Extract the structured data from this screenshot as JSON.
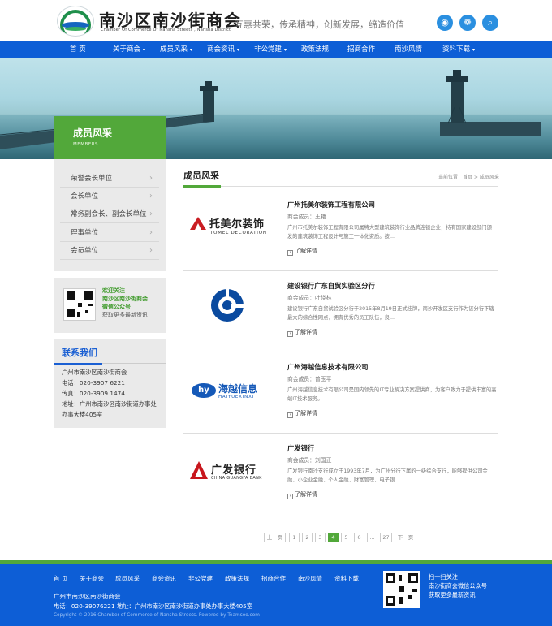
{
  "header": {
    "logo_cn": "南沙区南沙街商会",
    "logo_en": "Chamber Of Commerce Of Nansha Streets , Nansha District",
    "slogan": "互惠共荣，传承精神，创新发展，缔造价值"
  },
  "nav": [
    {
      "label": "首 页"
    },
    {
      "label": "关于商会",
      "dropdown": true
    },
    {
      "label": "成员风采",
      "dropdown": true
    },
    {
      "label": "商会资讯",
      "dropdown": true
    },
    {
      "label": "非公党建",
      "dropdown": true
    },
    {
      "label": "政策法规"
    },
    {
      "label": "招商合作"
    },
    {
      "label": "南沙风情"
    },
    {
      "label": "资料下载",
      "dropdown": true
    }
  ],
  "banner": {
    "title": "成员风采",
    "title_en": "MEMBERS"
  },
  "sidebar": {
    "items": [
      {
        "label": "荣誉会长单位"
      },
      {
        "label": "会长单位"
      },
      {
        "label": "常务副会长、副会长单位"
      },
      {
        "label": "理事单位"
      },
      {
        "label": "会员单位"
      }
    ],
    "qr": {
      "line1": "欢迎关注",
      "line2": "南沙区南沙街商会",
      "line3": "微信公众号",
      "line4": "获取更多最新资讯"
    },
    "contact": {
      "title": "联系我们",
      "org": "广州市南沙区南沙街商会",
      "phone": "电话：020-3907 6221",
      "fax": "传真：020-3909 1474",
      "address": "地址：广州市南沙区南沙街道办事处办事大楼405室"
    }
  },
  "main": {
    "title": "成员风采",
    "breadcrumb": "当前位置：首页 > 成员风采",
    "members": [
      {
        "name": "广州托美尔装饰工程有限公司",
        "role": "商会成员：王艳",
        "desc": "广州市托美尔装饰工程有限公司属特大型建筑装饰行业品牌连锁企业，持有国家建设部门颁发的建筑装饰工程设计与施工一体化资质。按...",
        "more": "了解详情",
        "logo_cn": "托美尔装饰",
        "logo_en": "TOMEL DECORATION"
      },
      {
        "name": "建设银行广东自贸实验区分行",
        "role": "商会成员：叶晓林",
        "desc": "建设银行广东自贸试验区分行于2015年8月19日正式挂牌，南沙开发区支行作为该分行下辖最大的综合性网点，拥有优秀的员工队伍，良...",
        "more": "了解详情"
      },
      {
        "name": "广州海越信息技术有限公司",
        "role": "商会成员：曾玉平",
        "desc": "广州海越信息技术有限公司是国内领先的IT专业解决方案提供商，为客户致力于提供丰富的高端IT技术服务。",
        "more": "了解详情",
        "logo_cn": "海越信息",
        "logo_en": "HAIYUEXINXI"
      },
      {
        "name": "广发银行",
        "role": "商会成员：刘国正",
        "desc": "广发银行南沙支行成立于1993年7月，为广州分行下属的一级综合支行，能够提供公司金融、小企业金融、个人金融、财富管理、电子银...",
        "more": "了解详情",
        "logo_cn": "广发银行",
        "logo_en": "CHINA GUANGFA BANK"
      }
    ]
  },
  "pagination": {
    "prev": "上一页",
    "pages": [
      "1",
      "2",
      "3",
      "4",
      "5",
      "6",
      "...",
      "27"
    ],
    "active": "4",
    "next": "下一页"
  },
  "footer": {
    "links": [
      "首 页",
      "关于商会",
      "成员风采",
      "商会资讯",
      "非公党建",
      "政策法规",
      "招商合作",
      "南沙风情",
      "资料下载"
    ],
    "org": "广州市南沙区南沙街商会",
    "contact_line": "电话：020-39076221   地址：广州市南沙区南沙街道办事处办事大楼405室",
    "copyright": "Copyright © 2016 Chamber of Commerce of Nansha Streets. Powered by Teamsoo.com",
    "qr_line1": "扫一扫关注",
    "qr_line2": "南沙街商会微信公众号",
    "qr_line3": "获取更多最新资讯"
  },
  "colors": {
    "nav_blue": "#0d5ed6",
    "accent_green": "#52a83a"
  }
}
